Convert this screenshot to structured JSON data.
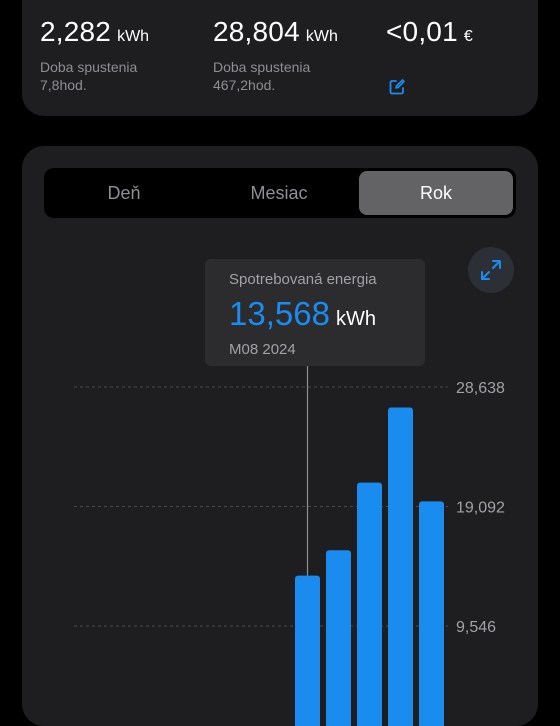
{
  "stats": [
    {
      "value": "2,282",
      "unit": "kWh",
      "label_line1": "Doba spustenia",
      "label_line2": "7,8hod."
    },
    {
      "value": "28,804",
      "unit": "kWh",
      "label_line1": "Doba spustenia",
      "label_line2": "467,2hod."
    },
    {
      "value": "<0,01",
      "unit": "€"
    }
  ],
  "icons": {
    "edit": "edit-icon",
    "expand": "expand-icon"
  },
  "tabs": [
    {
      "label": "Deň",
      "active": false
    },
    {
      "label": "Mesiac",
      "active": false
    },
    {
      "label": "Rok",
      "active": true
    }
  ],
  "tooltip": {
    "title": "Spotrebovaná energia",
    "value": "13,568",
    "unit": "kWh",
    "date": "M08 2024"
  },
  "colors": {
    "accent": "#1a8cf0",
    "background": "#000000",
    "card": "#1e1e21",
    "active_tab": "#636366"
  },
  "chart_data": {
    "type": "bar",
    "ylim": [
      0,
      28638
    ],
    "y_ticks": [
      "28,638",
      "19,092",
      "9,546"
    ],
    "y_tick_values": [
      28638,
      19092,
      9546
    ],
    "grid": true,
    "selected_index": 0,
    "values": [
      13568,
      15600,
      21000,
      27000,
      19500
    ]
  }
}
